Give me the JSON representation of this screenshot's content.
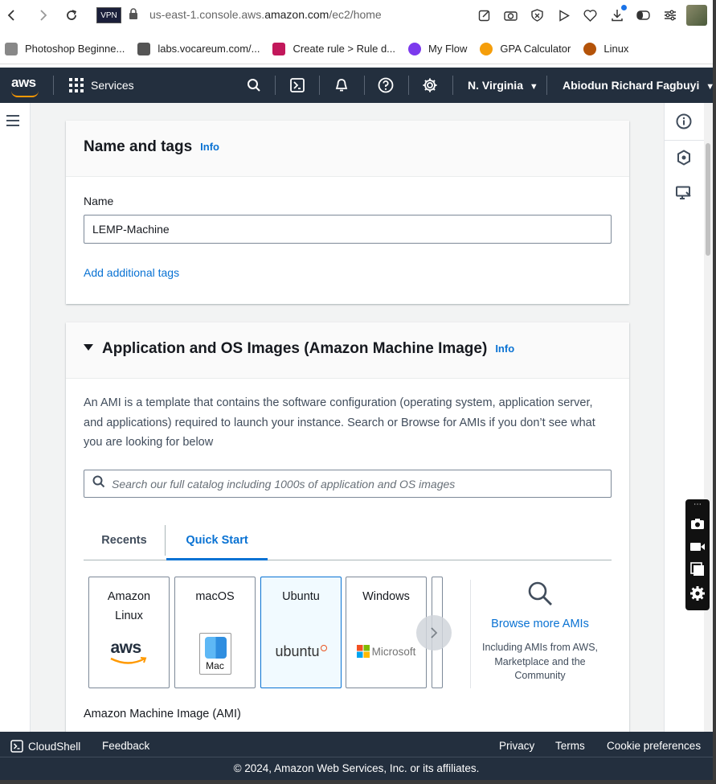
{
  "browser": {
    "vpn_label": "VPN",
    "url_prefix": "us-east-1.console.aws.",
    "url_domain": "amazon.com",
    "url_path": "/ec2/home"
  },
  "bookmarks": [
    {
      "label": "Photoshop Beginne...",
      "color": "#888888"
    },
    {
      "label": "labs.vocareum.com/...",
      "color": "#555555"
    },
    {
      "label": "Create rule > Rule d...",
      "color": "#c2185b"
    },
    {
      "label": "My Flow",
      "color": "#7c3aed"
    },
    {
      "label": "GPA Calculator",
      "color": "#f59e0b"
    },
    {
      "label": "Linux",
      "color": "#b45309"
    }
  ],
  "aws_nav": {
    "logo": "aws",
    "services_label": "Services",
    "region": "N. Virginia",
    "user": "Abiodun Richard Fagbuyi"
  },
  "name_section": {
    "title": "Name and tags",
    "info": "Info",
    "name_label": "Name",
    "name_value": "LEMP-Machine",
    "add_tags": "Add additional tags"
  },
  "ami_section": {
    "title": "Application and OS Images (Amazon Machine Image)",
    "info": "Info",
    "description": "An AMI is a template that contains the software configuration (operating system, application server, and applications) required to launch your instance. Search or Browse for AMIs if you don’t see what you are looking for below",
    "search_placeholder": "Search our full catalog including 1000s of application and OS images",
    "tabs": [
      "Recents",
      "Quick Start"
    ],
    "tiles": [
      {
        "name_line1": "Amazon",
        "name_line2": "Linux",
        "logo_text": "aws"
      },
      {
        "name_line1": "macOS",
        "name_line2": "",
        "logo_text": "Mac"
      },
      {
        "name_line1": "Ubuntu",
        "name_line2": "",
        "logo_text": "ubuntu"
      },
      {
        "name_line1": "Windows",
        "name_line2": "",
        "logo_text": "Microsoft"
      }
    ],
    "browse_title": "Browse more AMIs",
    "browse_sub": "Including AMIs from AWS, Marketplace and the Community",
    "ami_label": "Amazon Machine Image (AMI)"
  },
  "footer": {
    "cloudshell": "CloudShell",
    "feedback": "Feedback",
    "privacy": "Privacy",
    "terms": "Terms",
    "cookies": "Cookie preferences",
    "copyright": "© 2024, Amazon Web Services, Inc. or its affiliates."
  },
  "colors": {
    "aws_nav_bg": "#232f3e",
    "link_blue": "#0972d3",
    "aws_orange": "#ff9900"
  }
}
